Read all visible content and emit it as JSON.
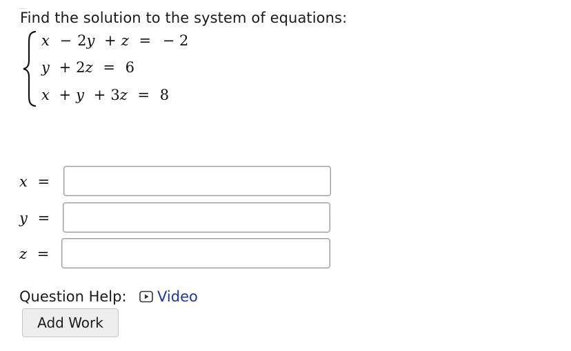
{
  "question": {
    "prompt": "Find the solution to the system of equations:"
  },
  "system": {
    "eq1": {
      "v1": "x",
      "op1": "−",
      "c2": "2",
      "v2": "y",
      "op2": "+",
      "v3": "z",
      "eq": "=",
      "rhs": "− 2"
    },
    "eq2": {
      "v1": "y",
      "op1": "+",
      "c2": "2",
      "v2": "z",
      "eq": "=",
      "rhs": "6"
    },
    "eq3": {
      "v1": "x",
      "op1": "+",
      "v2": "y",
      "op2": "+",
      "c3": "3",
      "v3": "z",
      "eq": "=",
      "rhs": "8"
    }
  },
  "answers": {
    "x": {
      "var": "x",
      "eq": "=",
      "value": ""
    },
    "y": {
      "var": "y",
      "eq": "=",
      "value": ""
    },
    "z": {
      "var": "z",
      "eq": "=",
      "value": ""
    }
  },
  "help": {
    "label": "Question Help:",
    "video_label": "Video",
    "video_icon": "play-box-icon",
    "link_color": "#1a36a8"
  },
  "actions": {
    "add_work_label": "Add Work"
  }
}
